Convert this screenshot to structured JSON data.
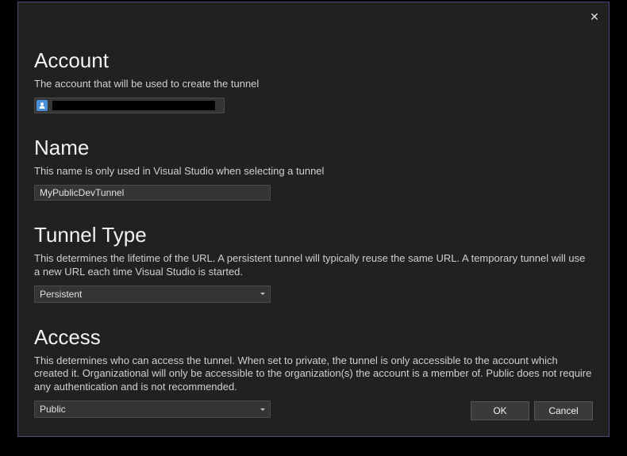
{
  "sections": {
    "account": {
      "heading": "Account",
      "description": "The account that will be used to create the tunnel"
    },
    "name": {
      "heading": "Name",
      "description": "This name is only used in Visual Studio when selecting a tunnel",
      "value": "MyPublicDevTunnel"
    },
    "tunnelType": {
      "heading": "Tunnel Type",
      "description": "This determines the lifetime of the URL. A persistent tunnel will typically reuse the same URL. A temporary tunnel will use a new URL each time Visual Studio is started.",
      "value": "Persistent"
    },
    "access": {
      "heading": "Access",
      "description": "This determines who can access the tunnel. When set to private, the tunnel is only accessible to the account which created it. Organizational will only be accessible to the organization(s) the account is a member of. Public does not require any authentication and is not recommended.",
      "value": "Public"
    }
  },
  "buttons": {
    "ok": "OK",
    "cancel": "Cancel"
  }
}
